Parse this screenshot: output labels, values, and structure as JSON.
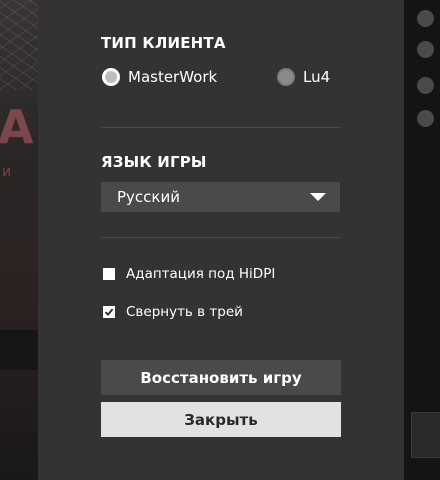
{
  "dialog": {
    "client_type": {
      "title": "ТИП КЛИЕНТА",
      "options": [
        {
          "label": "MasterWork",
          "selected": true
        },
        {
          "label": "Lu4",
          "selected": false
        }
      ]
    },
    "game_language": {
      "title": "ЯЗЫК ИГРЫ",
      "selected": "Русский"
    },
    "checkboxes": [
      {
        "label": "Адаптация под HiDPI",
        "checked": false
      },
      {
        "label": "Свернуть в трей",
        "checked": true
      }
    ],
    "buttons": {
      "restore": "Восстановить игру",
      "close": "Закрыть"
    }
  },
  "colors": {
    "panel_bg": "#333333",
    "button_dark": "#4a4a4a",
    "button_light": "#e2e2e2"
  }
}
